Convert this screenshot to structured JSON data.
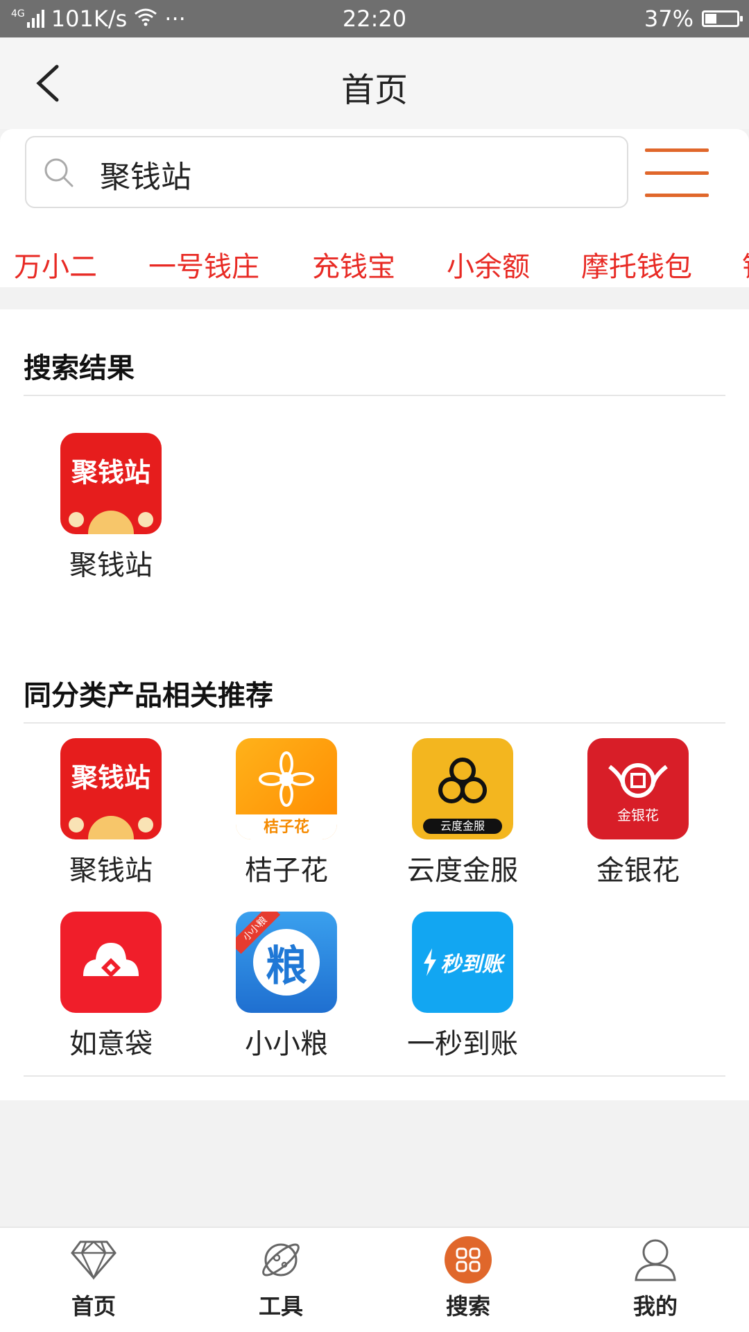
{
  "status_bar": {
    "network": "4G",
    "speed": "101K/s",
    "dots": "···",
    "time": "22:20",
    "battery": "37%",
    "battery_level": 0.37
  },
  "nav": {
    "title": "首页"
  },
  "search": {
    "value": "聚钱站"
  },
  "tags": [
    "万小二",
    "一号钱庄",
    "充钱宝",
    "小余额",
    "摩托钱包",
    "钱"
  ],
  "results_section": {
    "title": "搜索结果",
    "apps": [
      {
        "name": "聚钱站",
        "icon": "juqianzhan-app-icon",
        "icon_text": "聚钱站"
      }
    ]
  },
  "recommend_section": {
    "title": "同分类产品相关推荐",
    "apps": [
      {
        "name": "聚钱站",
        "icon": "juqianzhan-app-icon",
        "icon_text": "聚钱站"
      },
      {
        "name": "桔子花",
        "icon": "juzihua-app-icon",
        "icon_text": "桔子花"
      },
      {
        "name": "云度金服",
        "icon": "yundu-app-icon",
        "icon_text": "云度金服"
      },
      {
        "name": "金银花",
        "icon": "jinyinhua-app-icon",
        "icon_text": "金银花"
      },
      {
        "name": "如意袋",
        "icon": "ruyidai-app-icon"
      },
      {
        "name": "小小粮",
        "icon": "xiaoxiaoliang-app-icon",
        "icon_text": "粮",
        "badge": "小小粮"
      },
      {
        "name": "一秒到账",
        "icon": "yimiaodaozhang-app-icon",
        "icon_text": "秒到账"
      }
    ]
  },
  "tabbar": [
    {
      "label": "首页",
      "icon": "diamond-icon"
    },
    {
      "label": "工具",
      "icon": "planet-icon"
    },
    {
      "label": "搜索",
      "icon": "grid-icon",
      "active": true
    },
    {
      "label": "我的",
      "icon": "user-icon"
    }
  ],
  "colors": {
    "accent": "#e0672b",
    "tag_red": "#e82a24"
  }
}
